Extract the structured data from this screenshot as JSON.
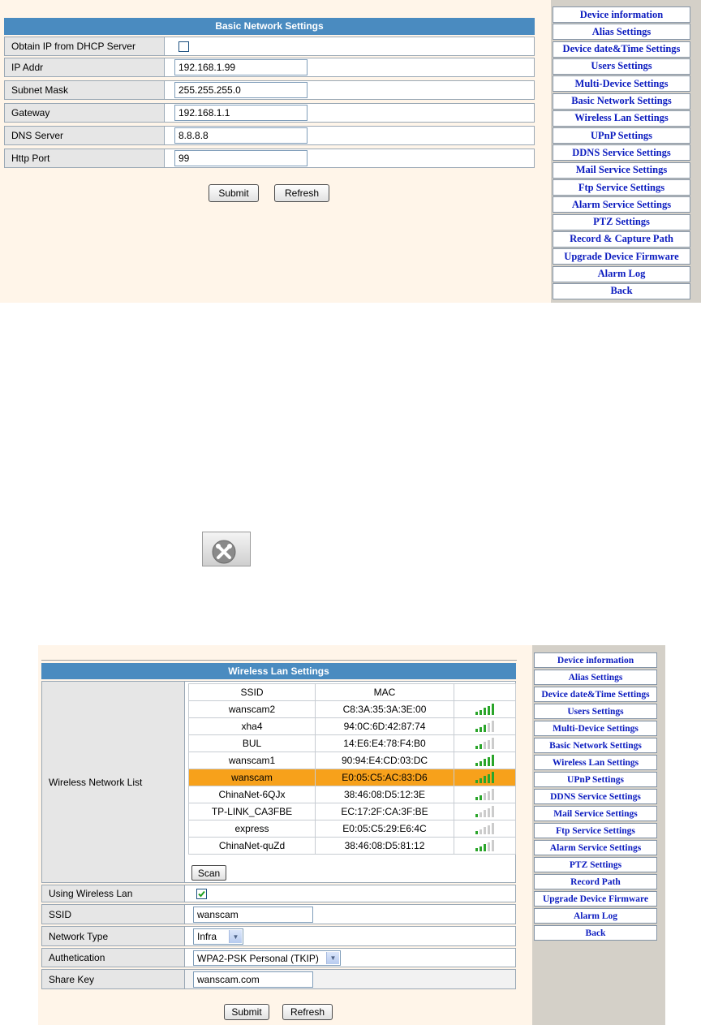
{
  "basic": {
    "title": "Basic Network Settings",
    "fields": [
      {
        "label": "Obtain IP from DHCP Server",
        "type": "checkbox",
        "checked": false
      },
      {
        "label": "IP Addr",
        "value": "192.168.1.99"
      },
      {
        "label": "Subnet Mask",
        "value": "255.255.255.0"
      },
      {
        "label": "Gateway",
        "value": "192.168.1.1"
      },
      {
        "label": "DNS Server",
        "value": "8.8.8.8"
      },
      {
        "label": "Http Port",
        "value": "99"
      }
    ],
    "submit_label": "Submit",
    "refresh_label": "Refresh"
  },
  "nav1": [
    "Device information",
    "Alias Settings",
    "Device date&Time Settings",
    "Users Settings",
    "Multi-Device Settings",
    "Basic Network Settings",
    "Wireless Lan Settings",
    "UPnP Settings",
    "DDNS Service Settings",
    "Mail Service Settings",
    "Ftp Service Settings",
    "Alarm Service Settings",
    "PTZ Settings",
    "Record & Capture Path",
    "Upgrade Device Firmware",
    "Alarm Log",
    "Back"
  ],
  "tool_icon": "tools-icon",
  "wireless": {
    "title": "Wireless Lan Settings",
    "list_label": "Wireless Network List",
    "col_ssid": "SSID",
    "col_mac": "MAC",
    "networks": [
      {
        "ssid": "wanscam2",
        "mac": "C8:3A:35:3A:3E:00",
        "signal": 5
      },
      {
        "ssid": "xha4",
        "mac": "94:0C:6D:42:87:74",
        "signal": 3
      },
      {
        "ssid": "BUL",
        "mac": "14:E6:E4:78:F4:B0",
        "signal": 2
      },
      {
        "ssid": "wanscam1",
        "mac": "90:94:E4:CD:03:DC",
        "signal": 5
      },
      {
        "ssid": "wanscam",
        "mac": "E0:05:C5:AC:83:D6",
        "signal": 5,
        "selected": true
      },
      {
        "ssid": "ChinaNet-6QJx",
        "mac": "38:46:08:D5:12:3E",
        "signal": 2
      },
      {
        "ssid": "TP-LINK_CA3FBE",
        "mac": "EC:17:2F:CA:3F:BE",
        "signal": 1
      },
      {
        "ssid": "express",
        "mac": "E0:05:C5:29:E6:4C",
        "signal": 1
      },
      {
        "ssid": "ChinaNet-quZd",
        "mac": "38:46:08:D5:81:12",
        "signal": 3
      }
    ],
    "scan_label": "Scan",
    "using_label": "Using Wireless Lan",
    "using_checked": true,
    "ssid_label": "SSID",
    "ssid_value": "wanscam",
    "nettype_label": "Network Type",
    "nettype_value": "Infra",
    "auth_label": "Authetication",
    "auth_value": "WPA2-PSK Personal (TKIP)",
    "key_label": "Share Key",
    "key_value": "wanscam.com",
    "submit_label": "Submit",
    "refresh_label": "Refresh"
  },
  "nav2": [
    "Device information",
    "Alias Settings",
    "Device date&Time Settings",
    "Users Settings",
    "Multi-Device Settings",
    "Basic Network Settings",
    "Wireless Lan Settings",
    "UPnP Settings",
    "DDNS Service Settings",
    "Mail Service Settings",
    "Ftp Service Settings",
    "Alarm Service Settings",
    "PTZ Settings",
    "Record Path",
    "Upgrade Device Firmware",
    "Alarm Log",
    "Back"
  ],
  "colors": {
    "header": "#4a8bc0",
    "panel": "#fff5e9",
    "nav_text": "#0b1bbf",
    "selected_row": "#f7a11b",
    "signal_on": "#2aa52a",
    "signal_off": "#cccccc"
  }
}
